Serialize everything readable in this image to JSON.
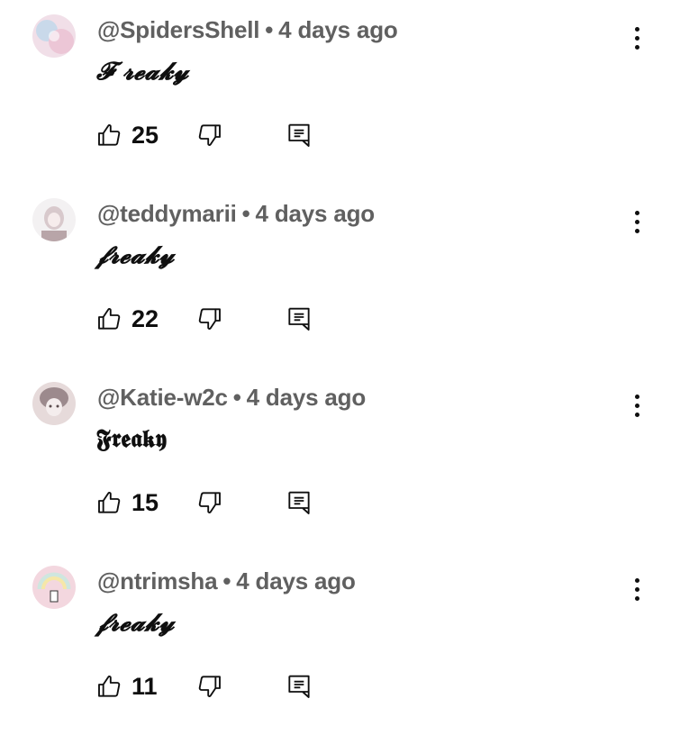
{
  "comments": [
    {
      "author": "@SpidersShell",
      "separator": "•",
      "time": "4 days ago",
      "text": "𝓕 𝓻𝓮𝓪𝓴𝔂",
      "style": "script",
      "likes": "25",
      "avatar_colors": [
        "#f1dfe8",
        "#c9d9ea",
        "#ecc6d6"
      ]
    },
    {
      "author": "@teddymarii",
      "separator": "•",
      "time": "4 days ago",
      "text": "𝓯𝓻𝓮𝓪𝓴𝔂",
      "style": "script",
      "likes": "22",
      "avatar_colors": [
        "#f3f1f2",
        "#d8c9cc",
        "#b8a5a8"
      ]
    },
    {
      "author": "@Katie-w2c",
      "separator": "•",
      "time": "4 days ago",
      "text": "𝕱𝖗𝖊𝖆𝖐𝖞",
      "style": "gothic",
      "likes": "15",
      "avatar_colors": [
        "#e6dada",
        "#9c8a8d",
        "#f4eded"
      ]
    },
    {
      "author": "@ntrimsha",
      "separator": "•",
      "time": "4 days ago",
      "text": "𝓯𝓻𝓮𝓪𝓴𝔂",
      "style": "script",
      "likes": "11",
      "avatar_colors": [
        "#f3d7df",
        "#cfe6df",
        "#f6e7a8"
      ]
    }
  ]
}
